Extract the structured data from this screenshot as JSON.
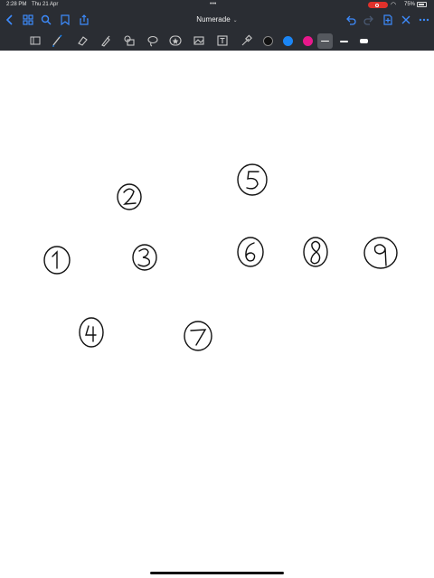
{
  "status": {
    "time": "2:28 PM",
    "date": "Thu 21 Apr",
    "battery": "75%"
  },
  "header": {
    "title": "Numerade"
  },
  "colors": {
    "chrome": "#2a2d33",
    "accent": "#1b86f5",
    "record": "#e0312b",
    "swatches": [
      "#111111",
      "#1b86f5",
      "#e8188c"
    ]
  },
  "toolbar": {
    "tools": [
      "sidebar-icon",
      "pen-icon",
      "eraser-icon",
      "highlighter-icon",
      "shapes-icon",
      "lasso-icon",
      "sticker-icon",
      "image-icon",
      "text-icon",
      "laser-pointer-icon"
    ]
  },
  "canvas": {
    "digits": [
      "1",
      "2",
      "3",
      "4",
      "5",
      "6",
      "7",
      "8",
      "9"
    ]
  }
}
